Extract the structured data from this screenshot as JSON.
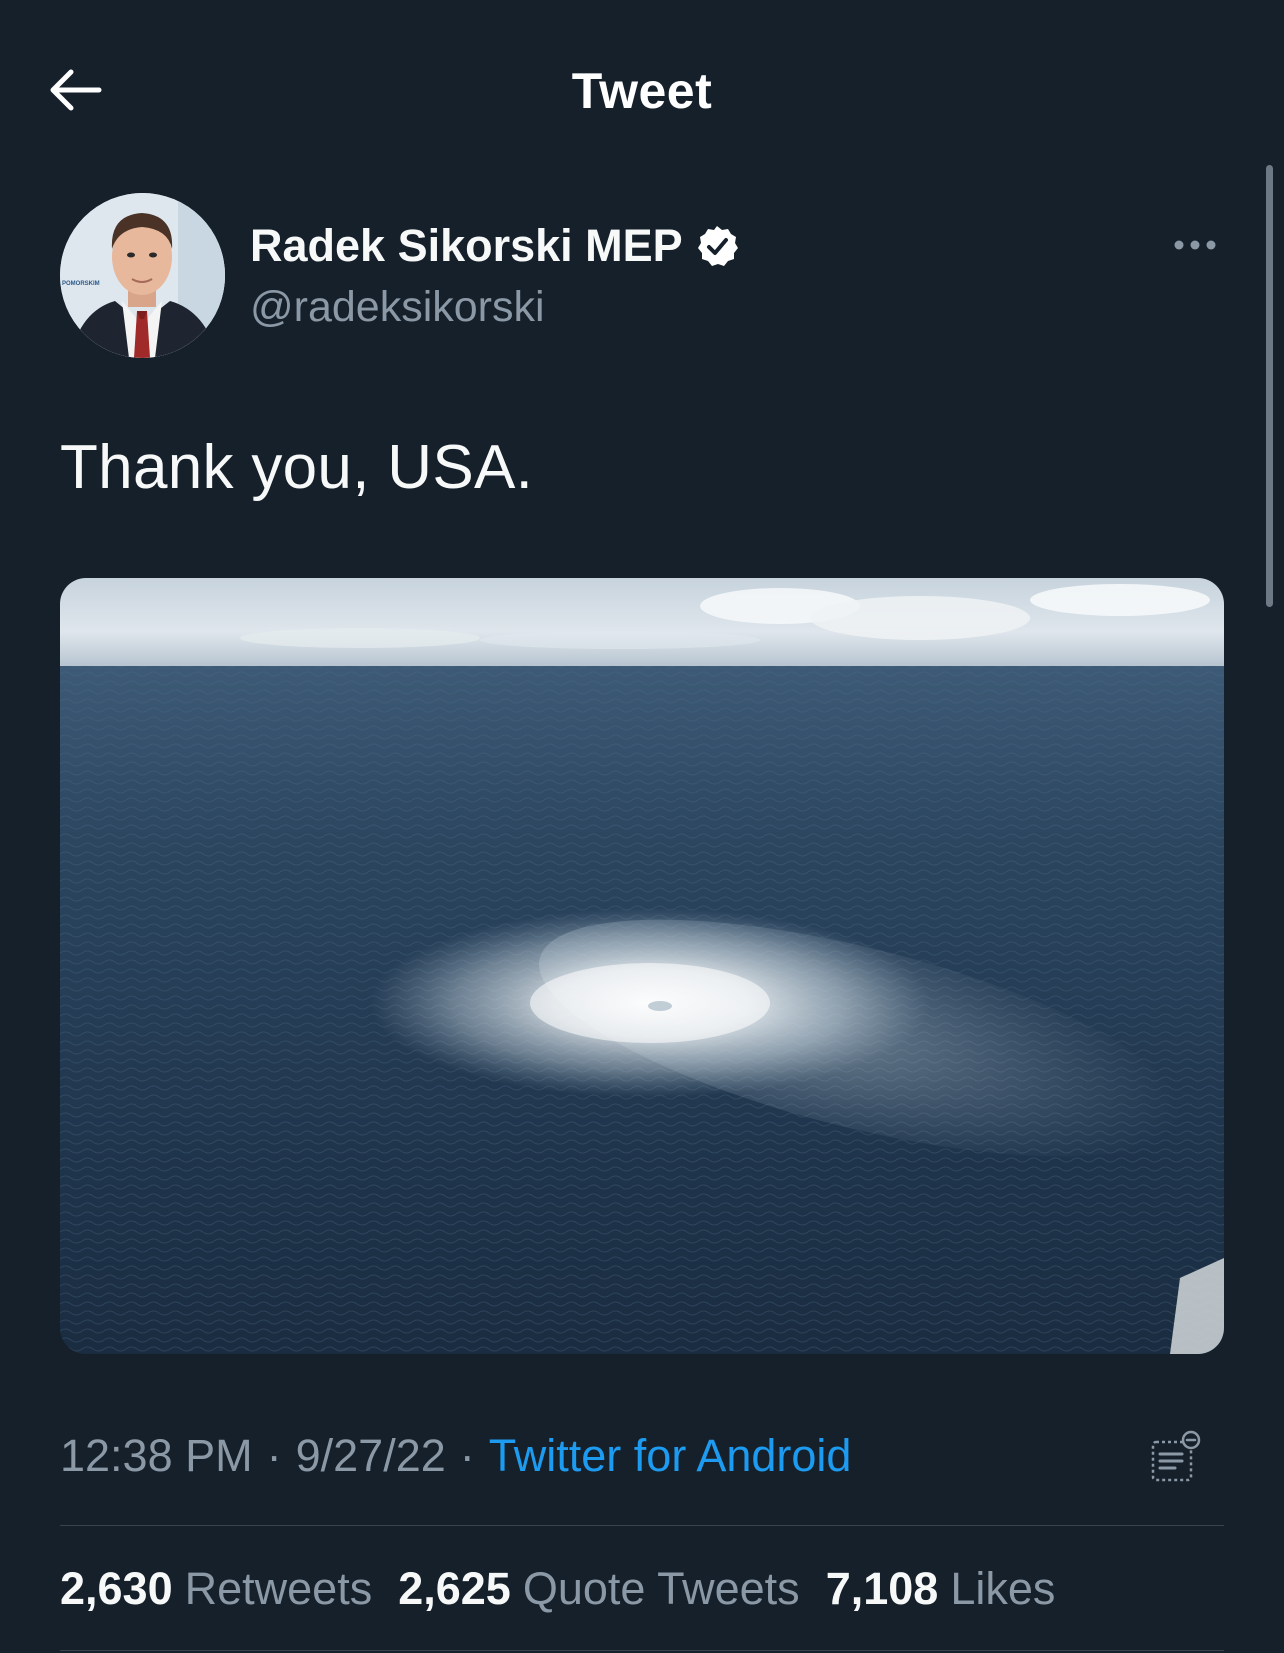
{
  "header": {
    "title": "Tweet",
    "back_icon": "arrow-left-icon"
  },
  "author": {
    "name": "Radek Sikorski MEP",
    "handle": "@radeksikorski",
    "verified": true,
    "verified_icon": "verified-badge-icon",
    "avatar_icon": "avatar-photo",
    "avatar_backdrop_text": "POMORSKIM"
  },
  "more_icon": "ellipsis-icon",
  "tweet": {
    "text": "Thank you, USA."
  },
  "media": {
    "icon": "photo-sea-gas-leak"
  },
  "meta": {
    "time": "12:38 PM",
    "date": "9/27/22",
    "separator": "·",
    "source": "Twitter for Android",
    "analytics_icon": "view-analytics-icon"
  },
  "stats": {
    "retweets_count": "2,630",
    "retweets_label": "Retweets",
    "quotes_count": "2,625",
    "quotes_label": "Quote Tweets",
    "likes_count": "7,108",
    "likes_label": "Likes"
  },
  "colors": {
    "background": "#15202b",
    "text_primary": "#f7f9f9",
    "text_secondary": "#8b98a5",
    "link": "#1d9bf0",
    "divider": "#38444d"
  }
}
